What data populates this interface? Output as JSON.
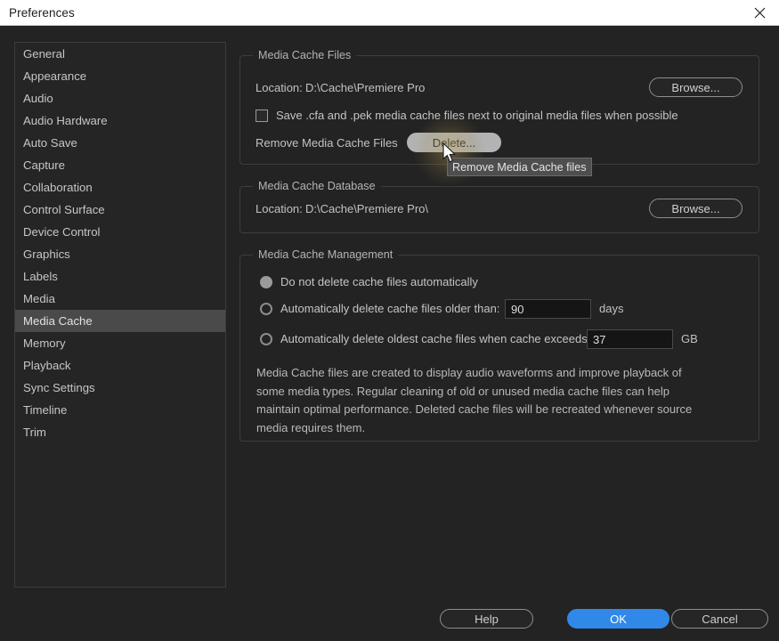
{
  "window": {
    "title": "Preferences",
    "close_icon": "close-icon"
  },
  "sidebar": {
    "items": [
      {
        "label": "General",
        "selected": false
      },
      {
        "label": "Appearance",
        "selected": false
      },
      {
        "label": "Audio",
        "selected": false
      },
      {
        "label": "Audio Hardware",
        "selected": false
      },
      {
        "label": "Auto Save",
        "selected": false
      },
      {
        "label": "Capture",
        "selected": false
      },
      {
        "label": "Collaboration",
        "selected": false
      },
      {
        "label": "Control Surface",
        "selected": false
      },
      {
        "label": "Device Control",
        "selected": false
      },
      {
        "label": "Graphics",
        "selected": false
      },
      {
        "label": "Labels",
        "selected": false
      },
      {
        "label": "Media",
        "selected": false
      },
      {
        "label": "Media Cache",
        "selected": true
      },
      {
        "label": "Memory",
        "selected": false
      },
      {
        "label": "Playback",
        "selected": false
      },
      {
        "label": "Sync Settings",
        "selected": false
      },
      {
        "label": "Timeline",
        "selected": false
      },
      {
        "label": "Trim",
        "selected": false
      }
    ]
  },
  "media_cache_files": {
    "group_title": "Media Cache Files",
    "location_label": "Location:",
    "location_value": "D:\\Cache\\Premiere Pro",
    "browse_label": "Browse...",
    "save_next_to_original_label": "Save .cfa and .pek media cache files next to original media files when possible",
    "save_next_to_original_checked": false,
    "remove_label": "Remove Media Cache Files",
    "delete_button_label": "Delete...",
    "delete_button_hovered": true
  },
  "media_cache_database": {
    "group_title": "Media Cache Database",
    "location_label": "Location:",
    "location_value": "D:\\Cache\\Premiere Pro\\",
    "browse_label": "Browse..."
  },
  "media_cache_management": {
    "group_title": "Media Cache Management",
    "options": [
      {
        "label": "Do not delete cache files automatically",
        "selected": true
      },
      {
        "label": "Automatically delete cache files older than:",
        "selected": false
      },
      {
        "label": "Automatically delete oldest cache files when cache exceeds:",
        "selected": false
      }
    ],
    "days_value": "90",
    "days_unit": "days",
    "size_value": "37",
    "size_unit": "GB",
    "description": "Media Cache files are created to display audio waveforms and improve playback of some media types.  Regular cleaning of old or unused media cache files can help maintain optimal performance. Deleted cache files will be recreated whenever source media requires them."
  },
  "tooltip": {
    "text": "Remove Media Cache files"
  },
  "footer": {
    "help_label": "Help",
    "ok_label": "OK",
    "cancel_label": "Cancel"
  },
  "colors": {
    "accent_blue": "#3089e8",
    "window_background": "#232323",
    "titlebar_background": "#ffffff",
    "selection": "#4a4a4a"
  }
}
